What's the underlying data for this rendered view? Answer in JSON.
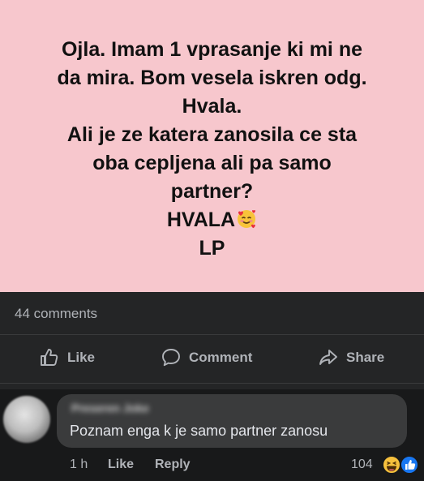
{
  "post": {
    "text": "Ojla. Imam 1 vprasanje ki mi ne\nda mira. Bom vesela iskren odg.\nHvala.\nAli je ze katera zanosila ce sta\noba cepljena ali pa samo\npartner?",
    "closing": "HVALA",
    "signature": "LP",
    "background_color": "#f7c7cd",
    "emoji_icon": "smiling-face-with-hearts-icon"
  },
  "stats": {
    "comments_count": "44 comments"
  },
  "actions": {
    "like_label": "Like",
    "comment_label": "Comment",
    "share_label": "Share"
  },
  "comment": {
    "author": "Preseren Joke",
    "text": "Poznam enga k je samo partner zanosu",
    "time": "1 h",
    "like_label": "Like",
    "reply_label": "Reply",
    "reaction_count": "104",
    "reaction_icons": [
      "haha-icon",
      "like-reaction-icon"
    ]
  },
  "colors": {
    "dark_bg": "#242526",
    "bubble_bg": "#3a3b3c",
    "secondary_text": "#b0b3b8",
    "like_blue": "#1877f2"
  }
}
